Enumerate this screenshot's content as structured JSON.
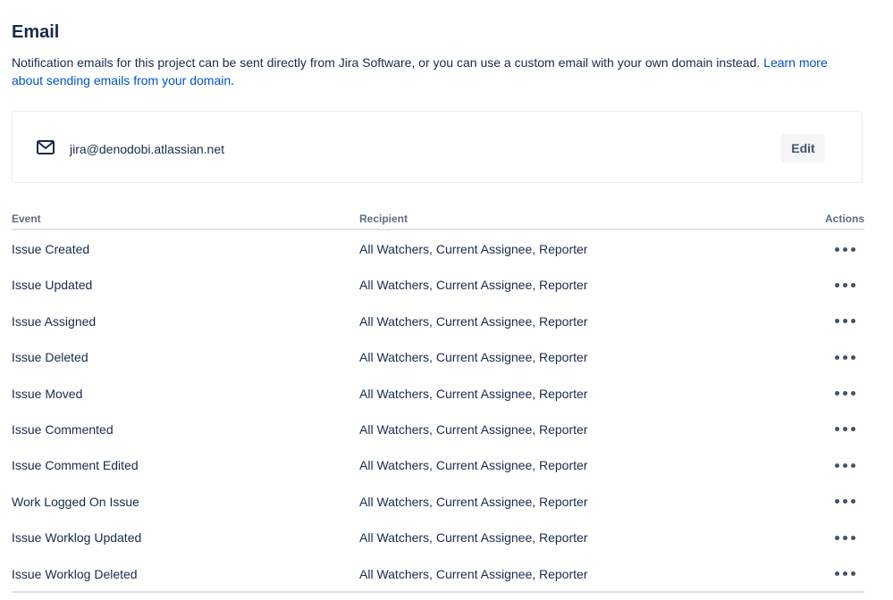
{
  "header": {
    "title": "Email",
    "description": "Notification emails for this project can be sent directly from Jira Software, or you can use a custom email with your own domain instead.",
    "learn_more_link": "Learn more about sending emails from your domain",
    "period": "."
  },
  "email_card": {
    "icon": "mail-icon",
    "address": "jira@denodobi.atlassian.net",
    "edit_label": "Edit"
  },
  "table": {
    "columns": {
      "event": "Event",
      "recipient": "Recipient",
      "actions": "Actions"
    },
    "rows": [
      {
        "event": "Issue Created",
        "recipient": "All Watchers, Current Assignee, Reporter"
      },
      {
        "event": "Issue Updated",
        "recipient": "All Watchers, Current Assignee, Reporter"
      },
      {
        "event": "Issue Assigned",
        "recipient": "All Watchers, Current Assignee, Reporter"
      },
      {
        "event": "Issue Deleted",
        "recipient": "All Watchers, Current Assignee, Reporter"
      },
      {
        "event": "Issue Moved",
        "recipient": "All Watchers, Current Assignee, Reporter"
      },
      {
        "event": "Issue Commented",
        "recipient": "All Watchers, Current Assignee, Reporter"
      },
      {
        "event": "Issue Comment Edited",
        "recipient": "All Watchers, Current Assignee, Reporter"
      },
      {
        "event": "Work Logged On Issue",
        "recipient": "All Watchers, Current Assignee, Reporter"
      },
      {
        "event": "Issue Worklog Updated",
        "recipient": "All Watchers, Current Assignee, Reporter"
      },
      {
        "event": "Issue Worklog Deleted",
        "recipient": "All Watchers, Current Assignee, Reporter"
      }
    ]
  },
  "colors": {
    "text": "#172b4d",
    "link": "#0052cc",
    "subtle": "#5e6c84",
    "button_bg": "#f4f5f7",
    "border": "#dfe1e6"
  }
}
